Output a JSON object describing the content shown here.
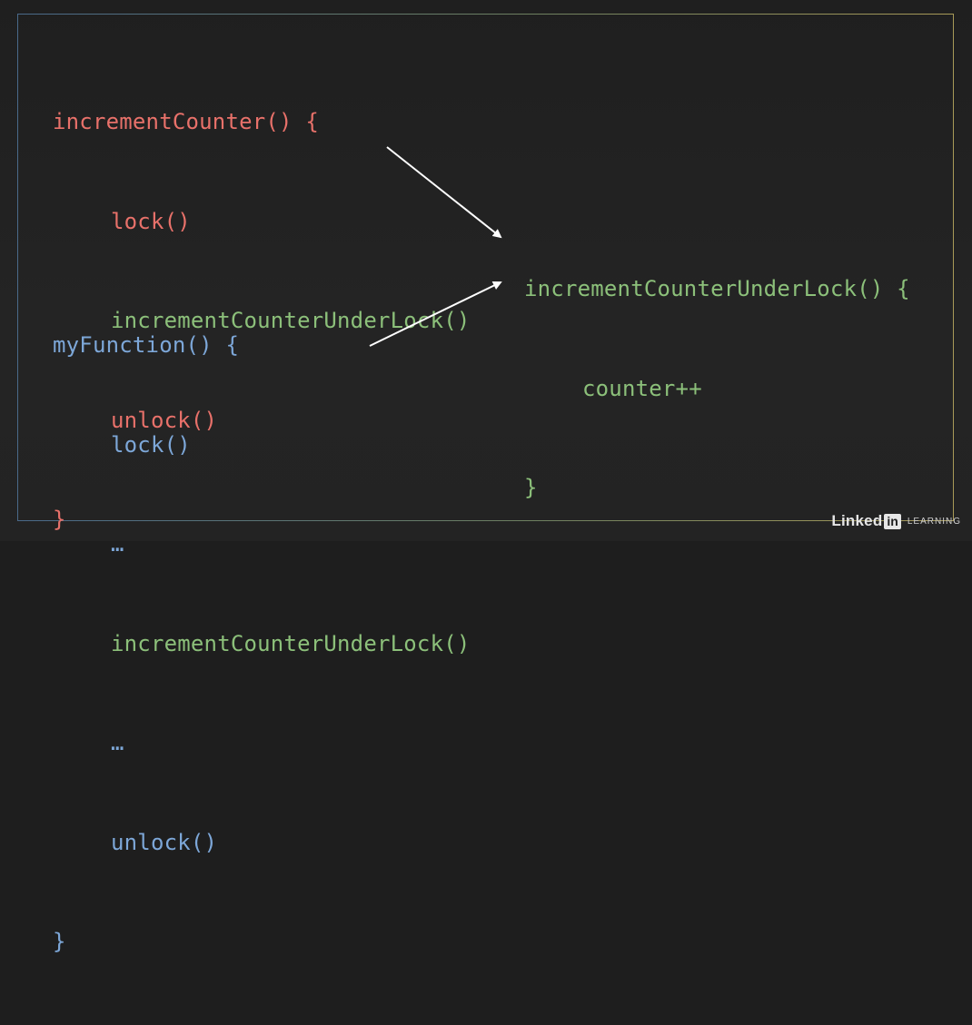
{
  "block_increment": {
    "header": "incrementCounter() {",
    "line1": "lock()",
    "line2": "incrementCounterUnderLock()",
    "line3": "unlock()",
    "close": "}"
  },
  "block_myfunction": {
    "header": "myFunction() {",
    "line1": "lock()",
    "line2": "…",
    "line3": "incrementCounterUnderLock()",
    "line4": "…",
    "line5": "unlock()",
    "close": "}"
  },
  "block_target": {
    "header": "incrementCounterUnderLock() {",
    "line1": "counter++",
    "close": "}"
  },
  "branding": {
    "name": "Linked",
    "in": "in",
    "suffix": "LEARNING"
  },
  "colors": {
    "red": "#e8716a",
    "green": "#8cc07a",
    "blue": "#7da7d8",
    "background": "#1e1e1e",
    "arrow": "#ffffff"
  }
}
